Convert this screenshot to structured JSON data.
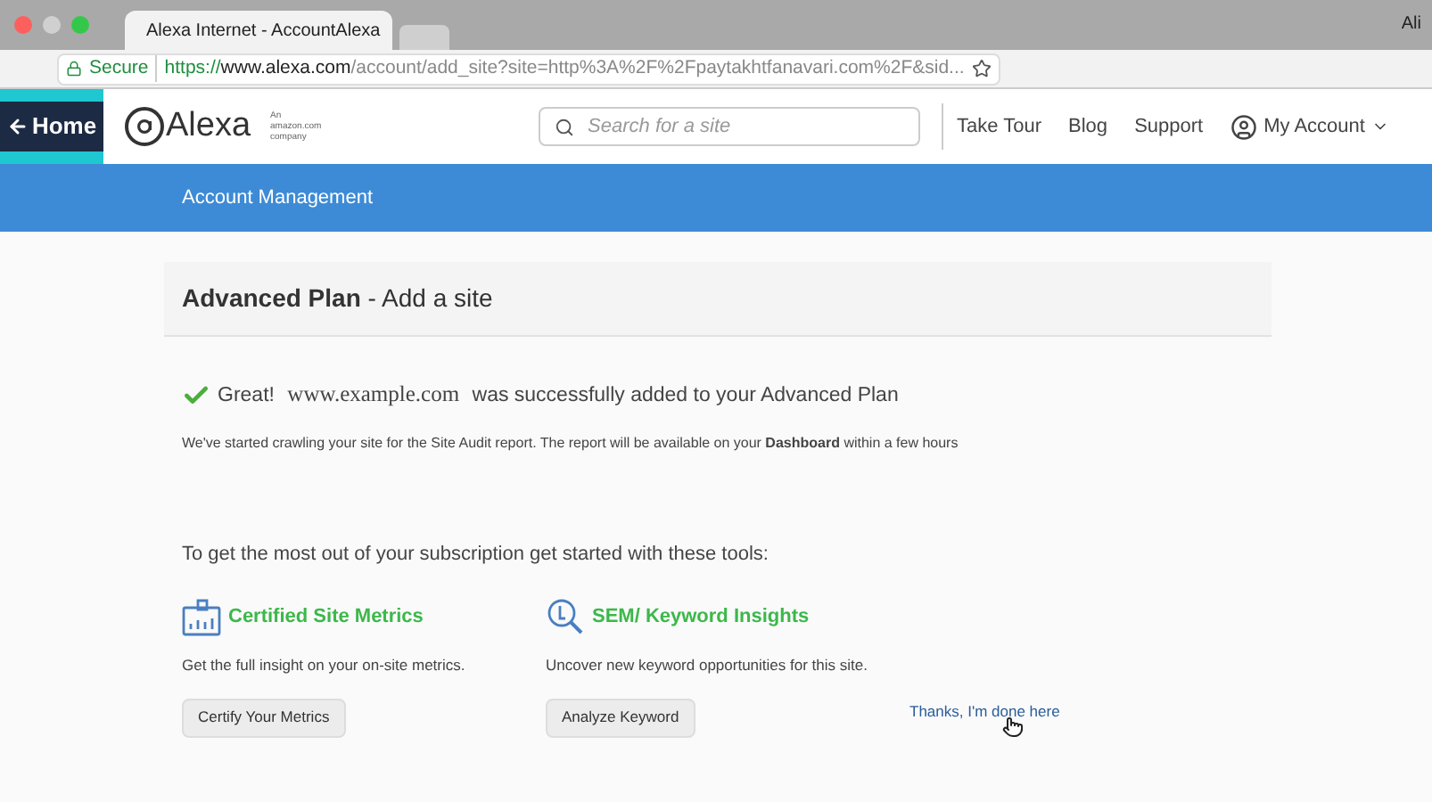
{
  "browser": {
    "tabs": [
      {
        "title": "Alexa Internet - AccountAlexa",
        "selected": true
      },
      {
        "selected": false
      }
    ],
    "user": "Ali",
    "address": {
      "secure_label": "Secure",
      "url_scheme": "https://",
      "url_host": "www.alexa.com",
      "url_rest": "/account/add_site?site=http%3A%2F%2Fpaytakhtfanavari.com%2F&sid..."
    }
  },
  "header": {
    "home_button": "Home",
    "logo": "Alexa",
    "tagline": "An amazon.com company",
    "search": {
      "placeholder": "Search for a site"
    },
    "nav": [
      "Take Tour",
      "Blog",
      "Support"
    ],
    "account": "My Account"
  },
  "banner": {
    "title": "Account Management"
  },
  "card": {
    "title_bold": "Advanced Plan",
    "title_rest": "- Add a site"
  },
  "success": {
    "lead": "Great!",
    "site": "www.example.com",
    "rest": "was successfully added to your Advanced Plan"
  },
  "info": "We've started crawling your site for the Site Audit report. The report will be available on your **Dashboard** within a few hours",
  "tools_intro": "To get the most out of your subscription get started with these tools:",
  "tools": [
    {
      "kind": "metrics",
      "title": "Certified Site Metrics",
      "description": "Get the full insight on your on-site metrics.",
      "button": "Certify Your Metrics"
    },
    {
      "kind": "keyword",
      "title": "SEM/ Keyword Insights",
      "description": "Uncover new keyword opportunities for this site.",
      "button": "Analyze Keyword"
    }
  ],
  "done_link": "Thanks, I'm done here"
}
